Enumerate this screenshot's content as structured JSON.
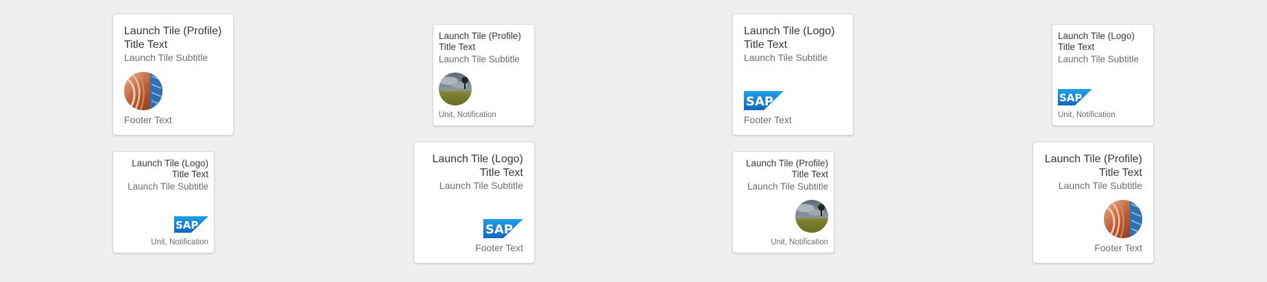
{
  "tiles": [
    {
      "title": "Launch Tile (Profile) Title Text",
      "subtitle": "Launch Tile Subtitle",
      "footer": "Footer Text",
      "visual": "profile-photo-icon"
    },
    {
      "title": "Launch Tile (Profile) Title Text",
      "subtitle": "Launch Tile Subtitle",
      "footer": "Unit, Notification",
      "visual": "landscape-photo-icon"
    },
    {
      "title": "Launch Tile (Logo) Title Text",
      "subtitle": "Launch Tile Subtitle",
      "footer": "Footer Text",
      "visual": "sap-logo"
    },
    {
      "title": "Launch Tile (Logo) Title Text",
      "subtitle": "Launch Tile Subtitle",
      "footer": "Unit, Notification",
      "visual": "sap-logo"
    },
    {
      "title": "Launch Tile (Logo) Title Text",
      "subtitle": "Launch Tile Subtitle",
      "footer": "Unit, Notification",
      "visual": "sap-logo"
    },
    {
      "title": "Launch Tile (Logo) Title Text",
      "subtitle": "Launch Tile Subtitle",
      "footer": "Footer Text",
      "visual": "sap-logo"
    },
    {
      "title": "Launch Tile (Profile) Title Text",
      "subtitle": "Launch Tile Subtitle",
      "footer": "Unit, Notification",
      "visual": "landscape-photo-icon"
    },
    {
      "title": "Launch Tile (Profile) Title Text",
      "subtitle": "Launch Tile Subtitle",
      "footer": "Footer Text",
      "visual": "profile-photo-icon"
    }
  ],
  "logo_text": "SAP",
  "colors": {
    "background": "#edeff0",
    "title": "#32363a",
    "subtitle": "#6a6d70",
    "sap_blue": "#1a73c9"
  }
}
